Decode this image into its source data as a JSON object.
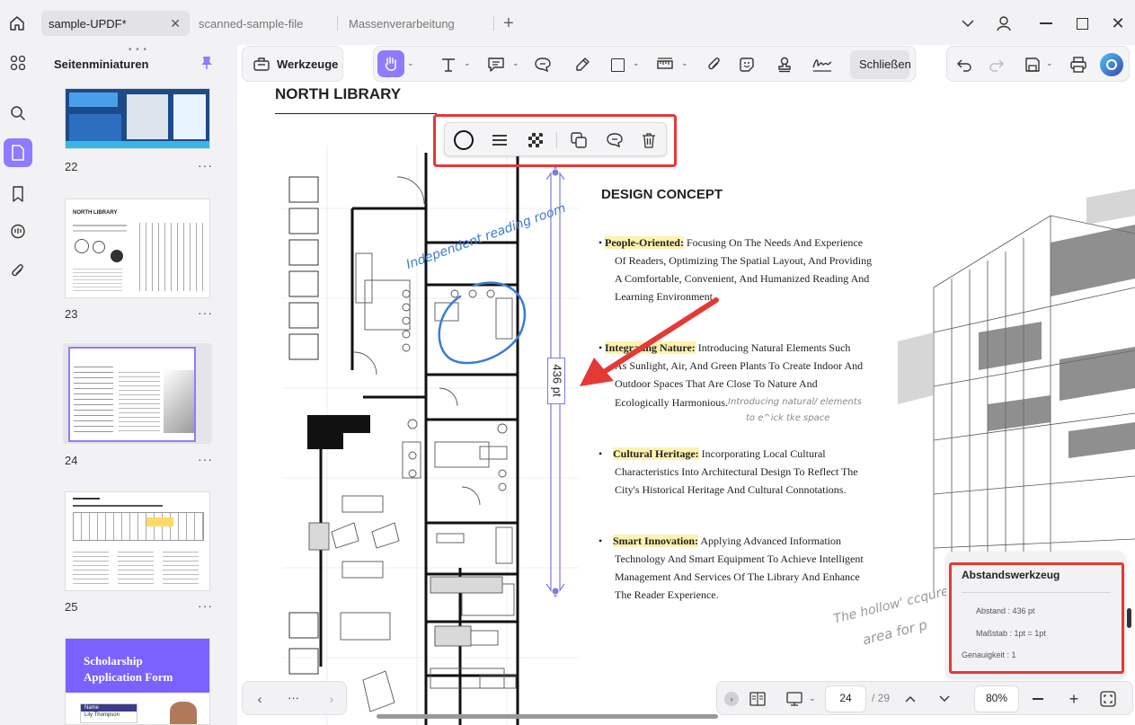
{
  "tabs": [
    {
      "label": "sample-UPDF*",
      "active": true
    },
    {
      "label": "scanned-sample-file",
      "active": false
    },
    {
      "label": "Massenverarbeitung",
      "active": false
    }
  ],
  "sidebar": {
    "title": "Seitenminiaturen",
    "pages": [
      {
        "num": "22",
        "more": "···"
      },
      {
        "num": "23",
        "more": "···"
      },
      {
        "num": "24",
        "more": "···"
      },
      {
        "num": "25",
        "more": "···"
      }
    ],
    "thumb23_title": "NORTH LIBRARY",
    "thumb26_title": "Scholarship Application Form",
    "thumb26_name": "Name",
    "thumb26_person": "Lily Thompson"
  },
  "toolbar": {
    "werkzeuge": "Werkzeuge",
    "schliessen": "Schließen"
  },
  "document": {
    "heading": "NORTH LIBRARY",
    "concept_title": "DESIGN CONCEPT",
    "handwritten_room": "Independent reading room",
    "measure_label": "436 pt",
    "bullets": [
      {
        "key": "People-Oriented:",
        "lines": [
          "Focusing On The      Needs And Experience",
          "Of Readers, Optimizing The Spatial Layout, And Providing",
          "A Comfortable, Convenient, And Humanized Reading And",
          "Learning Environment."
        ]
      },
      {
        "key": "Integrating Nature:",
        "lines": [
          "Introducing Natural Elements Such",
          "As Sunlight, Air, And Green Plants To Create Indoor And",
          "Outdoor Spaces That Are Close To Nature And",
          "Ecologically Harmonious."
        ]
      },
      {
        "key": "Cultural Heritage:",
        "lines": [
          "Incorporating Local Cultural",
          "Characteristics Into Architectural Design To Reflect The",
          "City's Historical Heritage And Cultural Connotations."
        ]
      },
      {
        "key": "Smart Innovation:",
        "lines": [
          "Applying Advanced Information",
          "Technology And Smart Equipment To Achieve Intelligent",
          "Management And Services Of The Library And Enhance",
          "The Reader Experience."
        ]
      }
    ],
    "handnote_1": "Introducing natural/ elements",
    "handnote_2": "to e^ick tke space",
    "handnote_3": "The hollow' ccqure Pr",
    "handnote_4": "area for p"
  },
  "measure_panel": {
    "title": "Abstandswerkzeug",
    "distance": "Abstand : 436 pt",
    "scale": "Maßstab : 1pt = 1pt",
    "accuracy": "Genauigkeit : 1"
  },
  "bottombar": {
    "more": "···",
    "page_current": "24",
    "page_total": "/ 29",
    "zoom": "80%"
  },
  "colors": {
    "accent": "#7b61ff",
    "highlight": "#e53935",
    "measure": "#7a7ae0"
  }
}
